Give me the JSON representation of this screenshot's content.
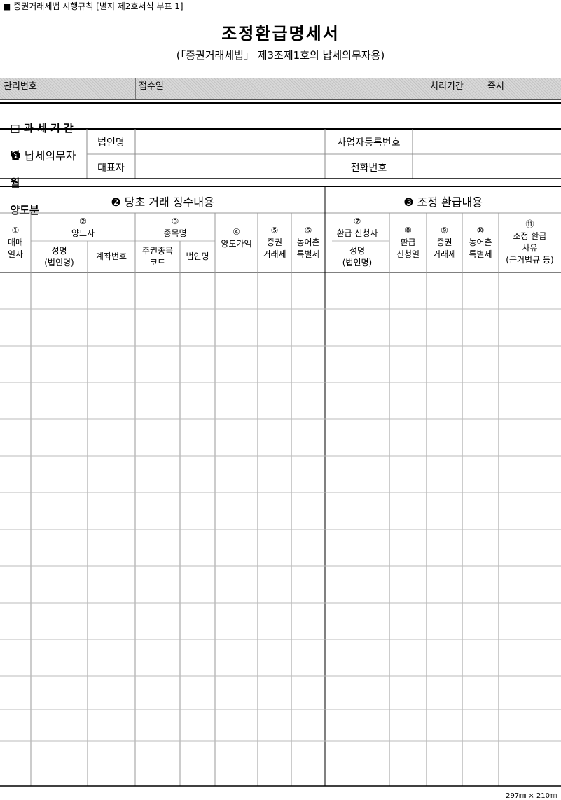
{
  "header_label": "■ 증권거래세법 시행규칙 [별지 제2호서식 부표 1]",
  "title": "조정환급명세서",
  "subtitle": "(「증권거래세법」 제3조제1호의 납세의무자용)",
  "admin": {
    "mgmt_no": "관리번호",
    "receipt_date": "접수일",
    "processing_label": "처리기간",
    "processing_value": "즉시"
  },
  "tax_period": {
    "label": "□ 과 세 기 간",
    "year": "년",
    "month": "월",
    "suffix": "양도분"
  },
  "taxpayer": {
    "section": "❶ 납세의무자",
    "corp_name": "법인명",
    "representative": "대표자",
    "biz_reg_no": "사업자등록번호",
    "phone": "전화번호"
  },
  "section2": "❷ 당초 거래 징수내용",
  "section3": "❸ 조정 환급내용",
  "columns": {
    "c1_num": "①",
    "c1_a": "매매",
    "c1_b": "일자",
    "c2_num": "②",
    "c2_title": "양도자",
    "c2a_a": "성명",
    "c2a_b": "(법인명)",
    "c2b": "계좌번호",
    "c3_num": "③",
    "c3_title": "종목명",
    "c3a_a": "주권종목",
    "c3a_b": "코드",
    "c3b": "법인명",
    "c4_num": "④",
    "c4": "양도가액",
    "c5_num": "⑤",
    "c5_a": "증권",
    "c5_b": "거래세",
    "c6_num": "⑥",
    "c6_a": "농어촌",
    "c6_b": "특별세",
    "c7_num": "⑦",
    "c7_title": "환급 신청자",
    "c7_a": "성명",
    "c7_b": "(법인명)",
    "c8_num": "⑧",
    "c8_a": "환급",
    "c8_b": "신청일",
    "c9_num": "⑨",
    "c9_a": "증권",
    "c9_b": "거래세",
    "c10_num": "⑩",
    "c10_a": "농어촌",
    "c10_b": "특별세",
    "c11_num": "⑪",
    "c11_a": "조정 환급",
    "c11_b": "사유",
    "c11_c": "(근거법규 등)"
  },
  "footer": "297㎜ × 210㎜"
}
